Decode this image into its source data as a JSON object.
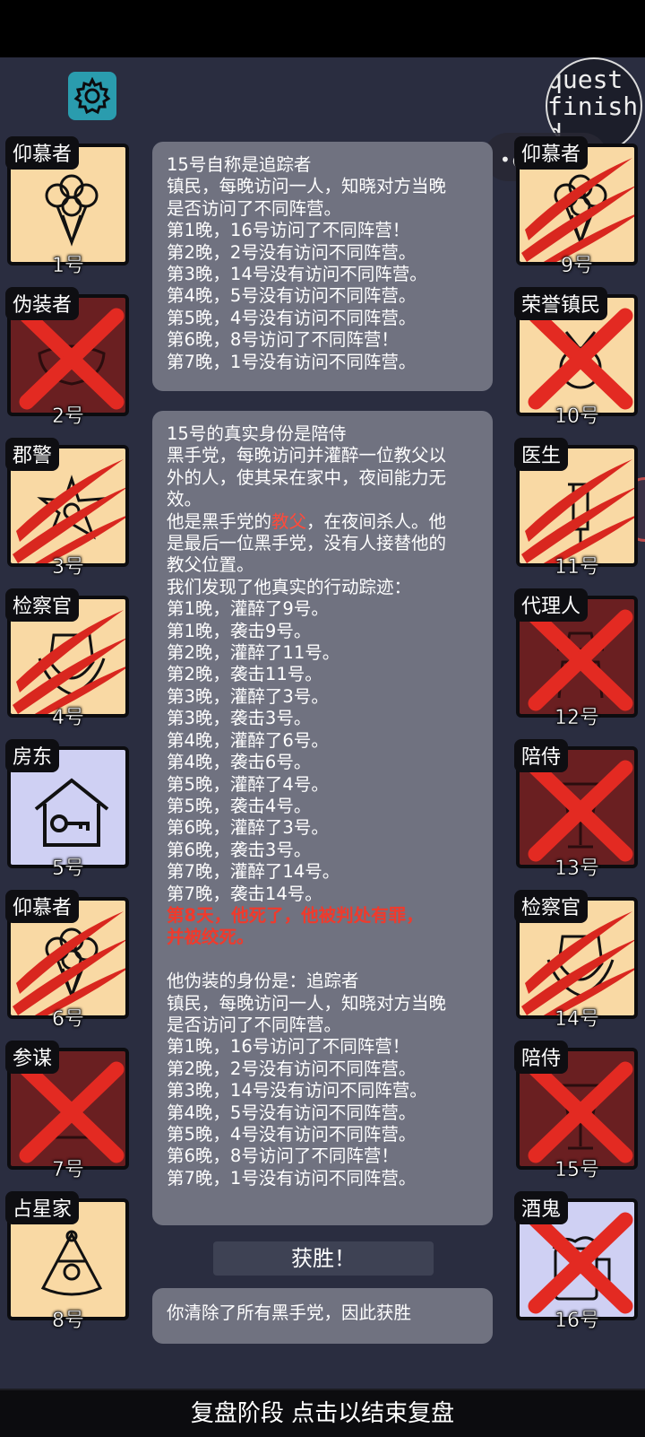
{
  "quest_badge": {
    "line1": "quest",
    "line2": "finish",
    "line3": "d"
  },
  "players_left": [
    {
      "role": "仰慕者",
      "num": "1号",
      "state": "alive"
    },
    {
      "role": "伪装者",
      "num": "2号",
      "state": "dead"
    },
    {
      "role": "郡警",
      "num": "3号",
      "state": "clawed"
    },
    {
      "role": "检察官",
      "num": "4号",
      "state": "clawed"
    },
    {
      "role": "房东",
      "num": "5号",
      "state": "alive"
    },
    {
      "role": "仰慕者",
      "num": "6号",
      "state": "clawed"
    },
    {
      "role": "参谋",
      "num": "7号",
      "state": "dead"
    },
    {
      "role": "占星家",
      "num": "8号",
      "state": "alive"
    }
  ],
  "players_right": [
    {
      "role": "仰慕者",
      "num": "9号",
      "state": "clawed"
    },
    {
      "role": "荣誉镇民",
      "num": "10号",
      "state": "crossed"
    },
    {
      "role": "医生",
      "num": "11号",
      "state": "clawed"
    },
    {
      "role": "代理人",
      "num": "12号",
      "state": "dead"
    },
    {
      "role": "陪侍",
      "num": "13号",
      "state": "dead"
    },
    {
      "role": "检察官",
      "num": "14号",
      "state": "clawed"
    },
    {
      "role": "陪侍",
      "num": "15号",
      "state": "dead"
    },
    {
      "role": "酒鬼",
      "num": "16号",
      "state": "crossed"
    }
  ],
  "bubble1": {
    "lines": [
      "15号自称是追踪者",
      "镇民，每晚访问一人，知晓对方当晚",
      "是否访问了不同阵营。",
      "第1晚，16号访问了不同阵营！",
      "第2晚，2号没有访问不同阵营。",
      "第3晚，14号没有访问不同阵营。",
      "第4晚，5号没有访问不同阵营。",
      "第5晚，4号没有访问不同阵营。",
      "第6晚，8号访问了不同阵营！",
      "第7晚，1号没有访问不同阵营。"
    ]
  },
  "bubble2": {
    "intro": [
      "15号的真实身份是陪侍",
      "黑手党，每晚访问并灌醉一位教父以",
      "外的人，使其呆在家中，夜间能力无",
      "效。"
    ],
    "mafia_pre": "他是黑手党的",
    "mafia_role": "教父",
    "mafia_post": "，在夜间杀人。他",
    "after": [
      "是最后一位黑手党，没有人接替他的",
      "教父位置。",
      "我们发现了他真实的行动踪迹：",
      "第1晚，灌醉了9号。",
      "第1晚，袭击9号。",
      "第2晚，灌醉了11号。",
      "第2晚，袭击11号。",
      "第3晚，灌醉了3号。",
      "第3晚，袭击3号。",
      "第4晚，灌醉了6号。",
      "第4晚，袭击6号。",
      "第5晚，灌醉了4号。",
      "第5晚，袭击4号。",
      "第6晚，灌醉了3号。",
      "第6晚，袭击3号。",
      "第7晚，灌醉了14号。",
      "第7晚，袭击14号。"
    ],
    "death": [
      "第8天，他死了，他被判处有罪，",
      "并被绞死。"
    ],
    "disguise": [
      "他伪装的身份是：追踪者",
      "镇民，每晚访问一人，知晓对方当晚",
      "是否访问了不同阵营。",
      "第1晚，16号访问了不同阵营！",
      "第2晚，2号没有访问不同阵营。",
      "第3晚，14号没有访问不同阵营。",
      "第4晚，5号没有访问不同阵营。",
      "第5晚，4号没有访问不同阵营。",
      "第6晚，8号访问了不同阵营！",
      "第7晚，1号没有访问不同阵营。"
    ]
  },
  "victory_label": "获胜！",
  "result_text": "你清除了所有黑手党，因此获胜",
  "bottom_bar": "复盘阶段 点击以结束复盘",
  "colors": {
    "accent_red": "#f03a2c",
    "card_cream": "#f9d9a4",
    "card_dead": "#6a1f21",
    "card_lilac": "#cfd0f3",
    "gear_teal": "#2a9cae"
  }
}
